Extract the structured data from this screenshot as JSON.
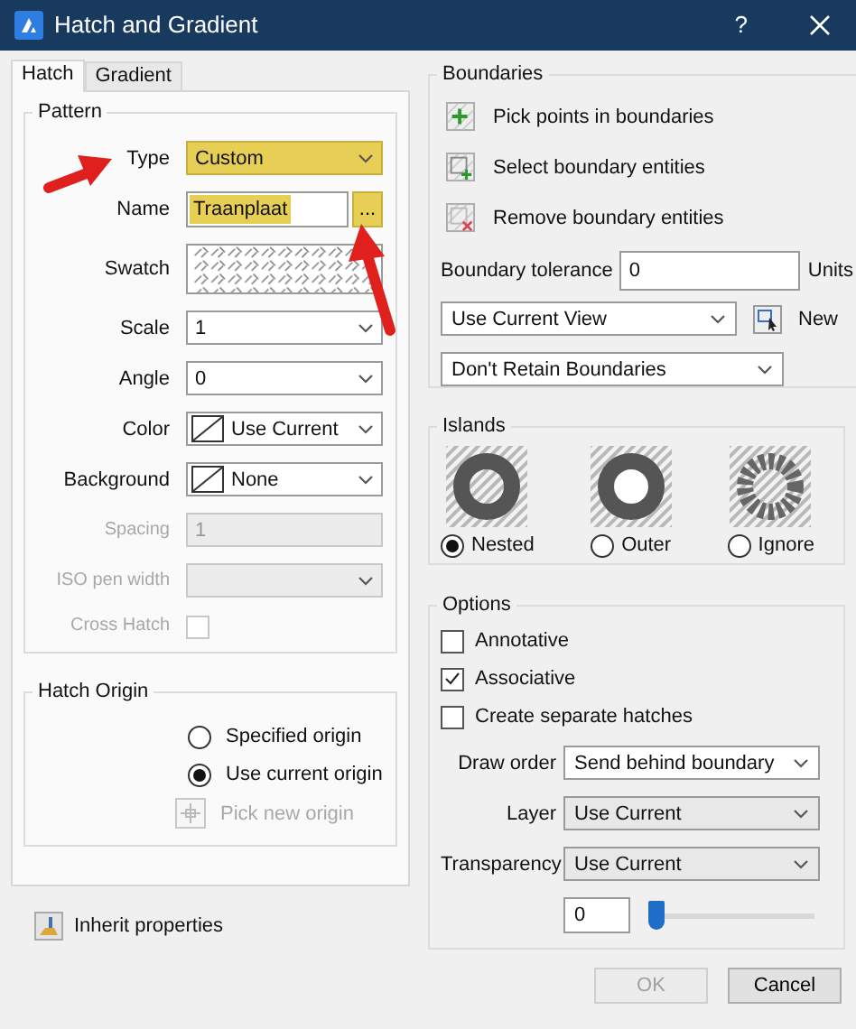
{
  "window": {
    "title": "Hatch and Gradient",
    "help": "?"
  },
  "tabs": [
    {
      "label": "Hatch",
      "selected": true
    },
    {
      "label": "Gradient",
      "selected": false
    }
  ],
  "pattern": {
    "title": "Pattern",
    "fields": [
      {
        "kind": "dropdown",
        "label": "Type",
        "value": "Custom",
        "highlighted": true,
        "disabled": false
      },
      {
        "kind": "browse",
        "label": "Name",
        "value": "Traanplaat",
        "button": "...",
        "highlighted": true,
        "disabled": false
      },
      {
        "kind": "swatch",
        "label": "Swatch",
        "highlighted": false,
        "disabled": false
      },
      {
        "kind": "dropdown",
        "label": "Scale",
        "value": "1",
        "highlighted": false,
        "disabled": false
      },
      {
        "kind": "dropdown",
        "label": "Angle",
        "value": "0",
        "highlighted": false,
        "disabled": false
      },
      {
        "kind": "color",
        "label": "Color",
        "value": "Use Current",
        "highlighted": false,
        "disabled": false
      },
      {
        "kind": "color",
        "label": "Background",
        "value": "None",
        "highlighted": false,
        "disabled": false
      },
      {
        "kind": "text",
        "label": "Spacing",
        "value": "1",
        "highlighted": false,
        "disabled": true
      },
      {
        "kind": "dropdown",
        "label": "ISO pen width",
        "highlighted": false,
        "disabled": true
      },
      {
        "kind": "checkbox",
        "label": "Cross Hatch",
        "checked": false,
        "highlighted": false,
        "disabled": true
      }
    ]
  },
  "hatch_origin": {
    "title": "Hatch Origin",
    "options": [
      {
        "label": "Specified origin",
        "selected": false
      },
      {
        "label": "Use current origin",
        "selected": true
      }
    ],
    "pick": {
      "label": "Pick new origin",
      "disabled": true
    }
  },
  "inherit": {
    "label": "Inherit properties"
  },
  "boundaries": {
    "title": "Boundaries",
    "actions": [
      {
        "kind": "pick",
        "label": "Pick points in boundaries"
      },
      {
        "kind": "select",
        "label": "Select boundary entities"
      },
      {
        "kind": "remove",
        "label": "Remove boundary entities"
      }
    ],
    "tolerance": {
      "label": "Boundary tolerance",
      "value": "0",
      "unit": "Units"
    },
    "view": {
      "value": "Use Current View",
      "new_label": "New"
    },
    "retain": {
      "value": "Don't Retain Boundaries"
    }
  },
  "islands": {
    "title": "Islands",
    "options": [
      {
        "kind": "nested",
        "label": "Nested",
        "selected": true
      },
      {
        "kind": "outer",
        "label": "Outer",
        "selected": false
      },
      {
        "kind": "ignore",
        "label": "Ignore",
        "selected": false
      }
    ]
  },
  "options": {
    "title": "Options",
    "checkboxes": [
      {
        "label": "Annotative",
        "checked": false
      },
      {
        "label": "Associative",
        "checked": true
      },
      {
        "label": "Create separate hatches",
        "checked": false
      }
    ],
    "fields": [
      {
        "label": "Draw order",
        "value": "Send behind boundary"
      },
      {
        "label": "Layer",
        "value": "Use Current"
      },
      {
        "label": "Transparency",
        "value": "Use Current"
      }
    ],
    "transparency": {
      "value": "0",
      "level": 0
    }
  },
  "buttons": [
    {
      "label": "OK",
      "disabled": true
    },
    {
      "label": "Cancel",
      "disabled": false
    }
  ]
}
